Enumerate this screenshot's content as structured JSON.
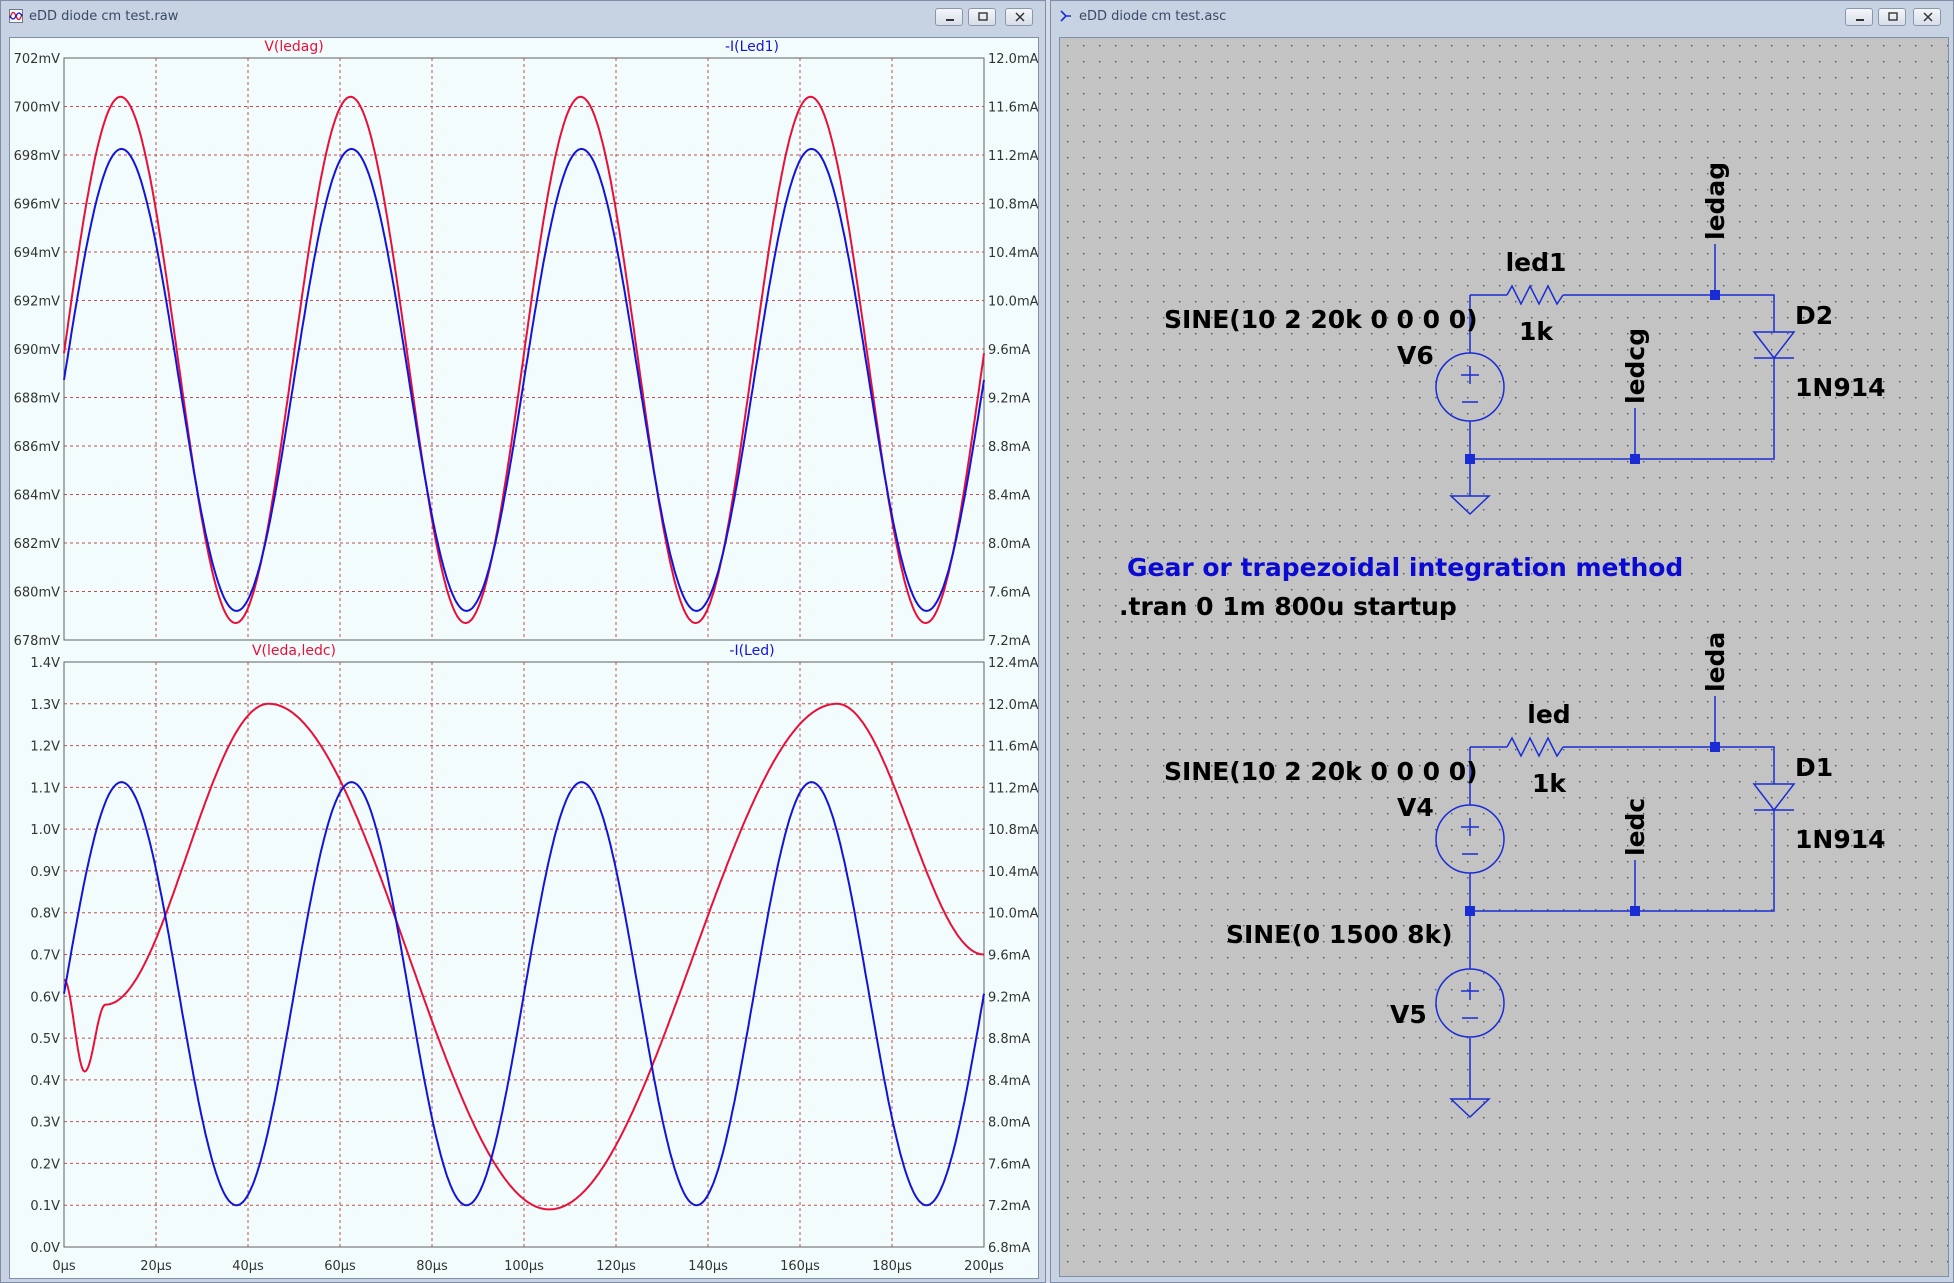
{
  "waveform_window": {
    "title": "eDD diode cm test.raw",
    "buttons": {
      "minimize": "minimize",
      "restore": "restore",
      "close": "close"
    }
  },
  "schematic_window": {
    "title": "eDD diode cm test.asc",
    "buttons": {
      "minimize": "minimize",
      "restore": "restore",
      "close": "close"
    }
  },
  "colors": {
    "red_trace": "#e8103a",
    "blue_trace": "#1414d8",
    "grid": "#c05050",
    "plot_bg": "#f2fcfc",
    "wire": "#1a2dd4",
    "schematic_bg": "#c3c3c3",
    "directive_blue": "#0a0ad0"
  },
  "chart_data": [
    {
      "type": "line",
      "title": "",
      "x": {
        "label": "",
        "unit": "µs",
        "range": [
          0,
          200
        ],
        "ticks": [
          "0µs",
          "20µs",
          "40µs",
          "60µs",
          "80µs",
          "100µs",
          "120µs",
          "140µs",
          "160µs",
          "180µs",
          "200µs"
        ]
      },
      "y_left": {
        "range": [
          678,
          702
        ],
        "unit": "mV",
        "ticks": [
          "678mV",
          "680mV",
          "682mV",
          "684mV",
          "686mV",
          "688mV",
          "690mV",
          "692mV",
          "694mV",
          "696mV",
          "698mV",
          "700mV",
          "702mV"
        ]
      },
      "y_right": {
        "range": [
          7.2,
          12.0
        ],
        "unit": "mA",
        "ticks": [
          "7.2mA",
          "7.6mA",
          "8.0mA",
          "8.4mA",
          "8.8mA",
          "9.2mA",
          "9.6mA",
          "10.0mA",
          "10.4mA",
          "10.8mA",
          "11.2mA",
          "11.6mA",
          "12.0mA"
        ]
      },
      "grid": true,
      "series": [
        {
          "name": "V(ledag)",
          "axis": "left",
          "color": "#e8103a",
          "shape": "sine",
          "period_us": 50,
          "min": 678.7,
          "max": 700.4,
          "peaks_us": [
            12.3,
            62.3,
            112.3,
            162.3
          ],
          "troughs_us": [
            37.5,
            87.5,
            137.5,
            187.5
          ]
        },
        {
          "name": "-I(Led1)",
          "axis": "right",
          "color": "#1414d8",
          "shape": "sine",
          "period_us": 50,
          "min": 7.44,
          "max": 11.25,
          "peaks_us": [
            12.5,
            62.5,
            112.5,
            162.5
          ],
          "troughs_us": [
            37.5,
            87.5,
            137.5,
            187.5
          ]
        }
      ]
    },
    {
      "type": "line",
      "title": "",
      "x": {
        "label": "",
        "unit": "µs",
        "range": [
          0,
          200
        ],
        "ticks": [
          "0µs",
          "20µs",
          "40µs",
          "60µs",
          "80µs",
          "100µs",
          "120µs",
          "140µs",
          "160µs",
          "180µs",
          "200µs"
        ]
      },
      "y_left": {
        "range": [
          0.0,
          1.4
        ],
        "unit": "V",
        "ticks": [
          "0.0V",
          "0.1V",
          "0.2V",
          "0.3V",
          "0.4V",
          "0.5V",
          "0.6V",
          "0.7V",
          "0.8V",
          "0.9V",
          "1.0V",
          "1.1V",
          "1.2V",
          "1.3V",
          "1.4V"
        ]
      },
      "y_right": {
        "range": [
          6.8,
          12.4
        ],
        "unit": "mA",
        "ticks": [
          "6.8mA",
          "7.2mA",
          "7.6mA",
          "8.0mA",
          "8.4mA",
          "8.8mA",
          "9.2mA",
          "9.6mA",
          "10.0mA",
          "10.4mA",
          "10.8mA",
          "11.2mA",
          "11.6mA",
          "12.0mA",
          "12.4mA"
        ]
      },
      "grid": true,
      "series": [
        {
          "name": "V(leda,ledc)",
          "axis": "left",
          "color": "#e8103a",
          "shape": "sine_plus_transient",
          "period_us": 125,
          "min": 0.09,
          "max": 1.3,
          "peaks_us": [
            44.5,
            168
          ],
          "troughs_us": [
            4.5,
            105.5
          ],
          "start_value": 0.64
        },
        {
          "name": "-I(Led)",
          "axis": "right",
          "color": "#1414d8",
          "shape": "sine",
          "period_us": 50,
          "min": 7.2,
          "max": 11.25,
          "peaks_us": [
            12.5,
            62.5,
            112.5,
            162.5
          ],
          "troughs_us": [
            37.5,
            87.5,
            137.5,
            187.5
          ]
        }
      ]
    }
  ],
  "schematic": {
    "top": {
      "source_value": "SINE(10 2 20k 0 0 0 0)",
      "source_name": "V6",
      "resistor_name": "led1",
      "resistor_value": "1k",
      "node_label_out": "ledag",
      "node_label_gnd": "ledcg",
      "diode_name": "D2",
      "diode_model": "1N914"
    },
    "directive_comment": "Gear or trapezoidal integration method",
    "directive_tran": ".tran 0 1m 800u startup",
    "bottom": {
      "source_value": "SINE(10 2 20k 0 0 0 0)",
      "source_name": "V4",
      "resistor_name": "led",
      "resistor_value": "1k",
      "node_label_out": "leda",
      "node_label_gnd": "ledc",
      "diode_name": "D1",
      "diode_model": "1N914",
      "cm_source_value": "SINE(0 1500 8k)",
      "cm_source_name": "V5"
    }
  }
}
